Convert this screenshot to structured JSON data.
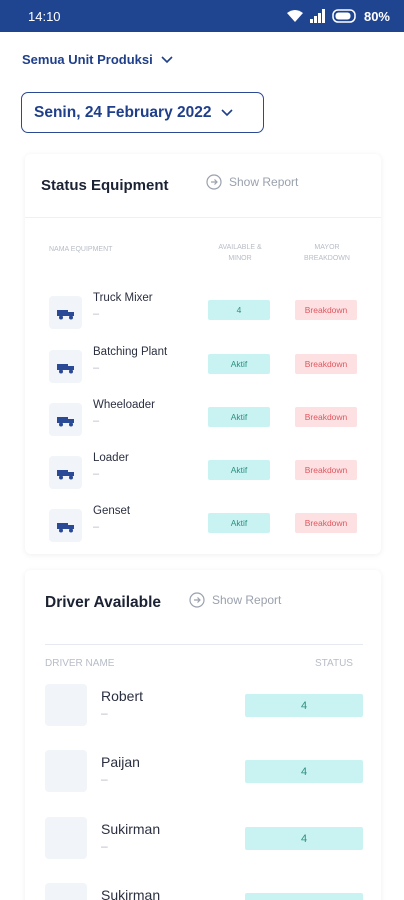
{
  "status_bar": {
    "time": "14:10",
    "battery": "80%"
  },
  "unit_selector": {
    "label": "Semua Unit Produksi"
  },
  "date_selector": {
    "label": "Senin, 24 February 2022"
  },
  "equipment": {
    "title": "Status Equipment",
    "show_report": "Show Report",
    "columns": {
      "name": "NAMA EQUIPMENT",
      "available_line1": "AVAILABLE &",
      "available_line2": "MINOR",
      "major_line1": "MAYOR",
      "major_line2": "BREAKDOWN"
    },
    "rows": [
      {
        "name": "Truck Mixer",
        "sub": "–",
        "available": "4",
        "major": "Breakdown"
      },
      {
        "name": "Batching Plant",
        "sub": "–",
        "available": "Aktif",
        "major": "Breakdown"
      },
      {
        "name": "Wheeloader",
        "sub": "–",
        "available": "Aktif",
        "major": "Breakdown"
      },
      {
        "name": "Loader",
        "sub": "–",
        "available": "Aktif",
        "major": "Breakdown"
      },
      {
        "name": "Genset",
        "sub": "–",
        "available": "Aktif",
        "major": "Breakdown"
      }
    ]
  },
  "drivers": {
    "title": "Driver Available",
    "show_report": "Show Report",
    "columns": {
      "name": "DRIVER NAME",
      "status": "STATUS"
    },
    "rows": [
      {
        "name": "Robert",
        "sub": "–",
        "status": "4"
      },
      {
        "name": "Paijan",
        "sub": "–",
        "status": "4"
      },
      {
        "name": "Sukirman",
        "sub": "–",
        "status": "4"
      },
      {
        "name": "Sukirman",
        "sub": "",
        "status": ""
      }
    ]
  },
  "colors": {
    "primary": "#1f4591",
    "available_bg": "#c9f2f3",
    "breakdown_bg": "#fde0e2",
    "breakdown_text": "#e0575f"
  }
}
